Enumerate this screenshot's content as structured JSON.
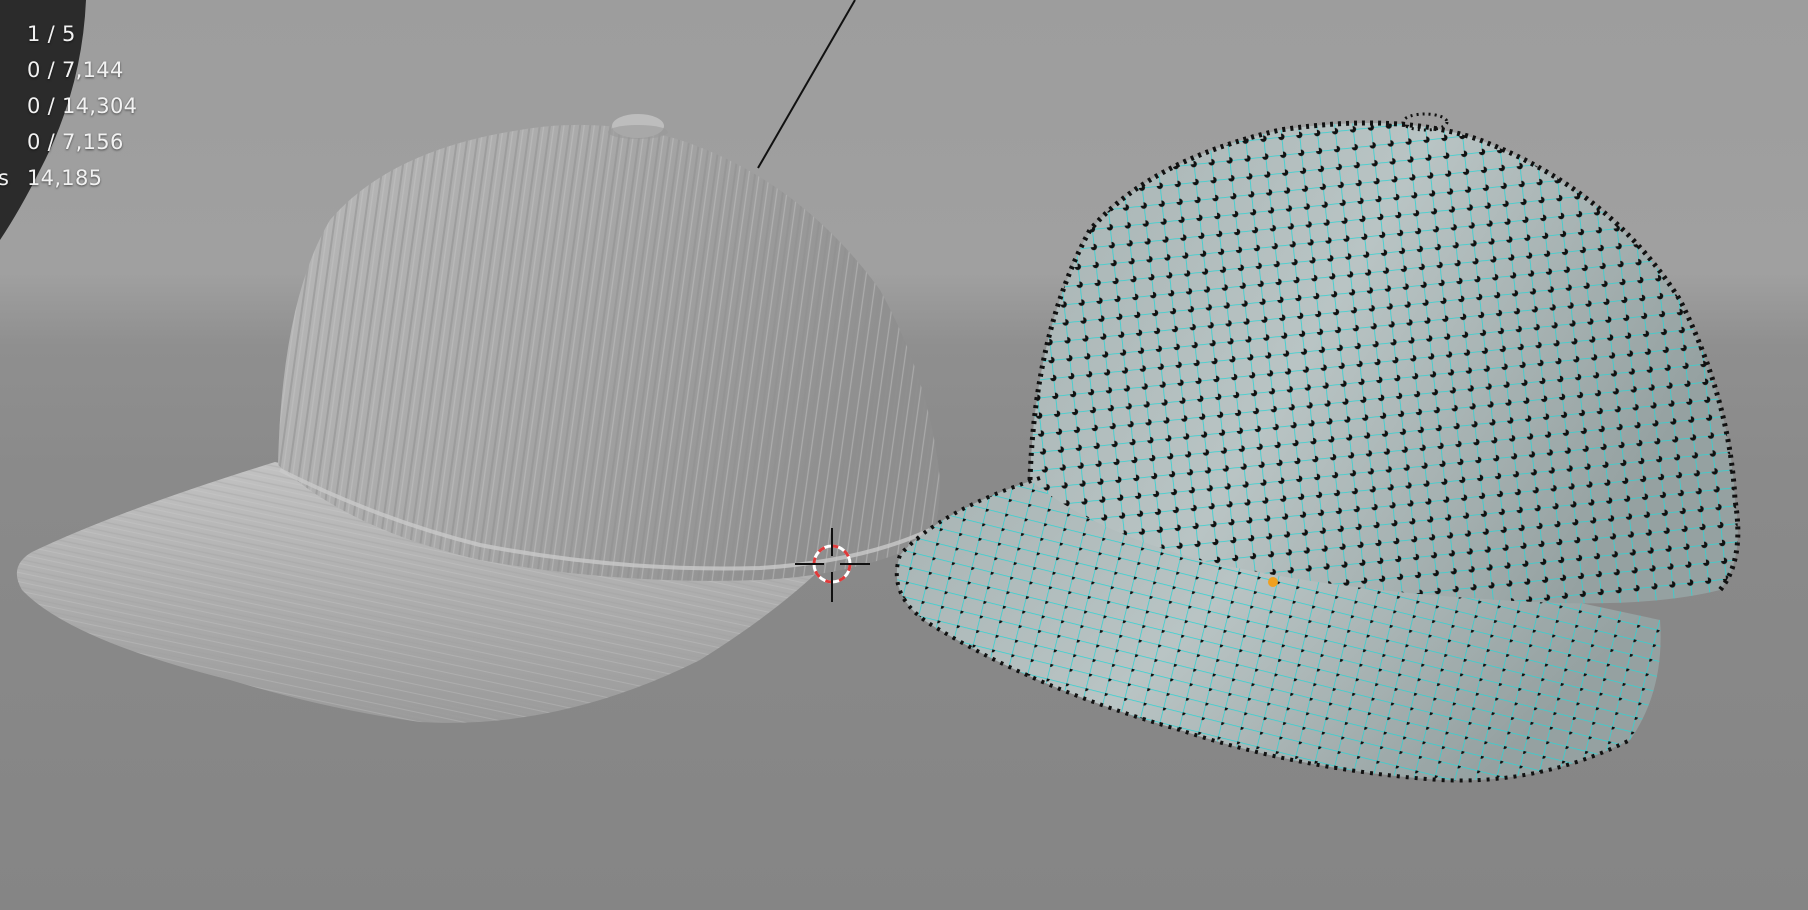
{
  "viewport": {
    "stats": {
      "objects": "1 / 5",
      "vertices": "0 / 7,144",
      "edges": "0 / 14,304",
      "faces": "0 / 7,156",
      "triangles_label_fragment": "s",
      "triangles": "14,185"
    }
  },
  "colors": {
    "wire": "#2fd3d3",
    "vertex": "#111111",
    "sculpt_surface": "#a6a6a6",
    "origin": "#f0a020",
    "cursor_ring_red": "#e03a3a"
  },
  "icons": {
    "cursor": "3d-cursor-icon",
    "origin": "object-origin-dot"
  }
}
